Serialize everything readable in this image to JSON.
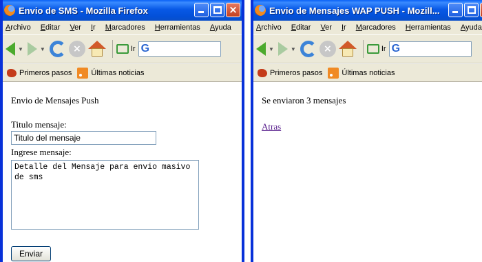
{
  "left_window": {
    "title": "Envio de SMS - Mozilla Firefox",
    "menu": [
      "Archivo",
      "Editar",
      "Ver",
      "Ir",
      "Marcadores",
      "Herramientas",
      "Ayuda"
    ],
    "go_label": "Ir",
    "bookmarks": [
      "Primeros pasos",
      "Últimas noticias"
    ],
    "page": {
      "heading": "Envio de Mensajes Push",
      "title_label": "Titulo mensaje:",
      "title_value": "Titulo del mensaje",
      "message_label": "Ingrese mensaje:",
      "message_value": "Detalle del Mensaje para envio masivo de sms",
      "send_button": "Enviar"
    }
  },
  "right_window": {
    "title": "Envio de Mensajes WAP PUSH - Mozill...",
    "menu": [
      "Archivo",
      "Editar",
      "Ver",
      "Ir",
      "Marcadores",
      "Herramientas",
      "Ayuda"
    ],
    "go_label": "Ir",
    "bookmarks": [
      "Primeros pasos",
      "Últimas noticias"
    ],
    "page": {
      "result_text": "Se enviaron 3 mensajes",
      "back_link": "Atras"
    }
  },
  "colors": {
    "title_bar": "#0859e6",
    "chrome": "#ece9d8",
    "link_visited": "#551a8b"
  }
}
